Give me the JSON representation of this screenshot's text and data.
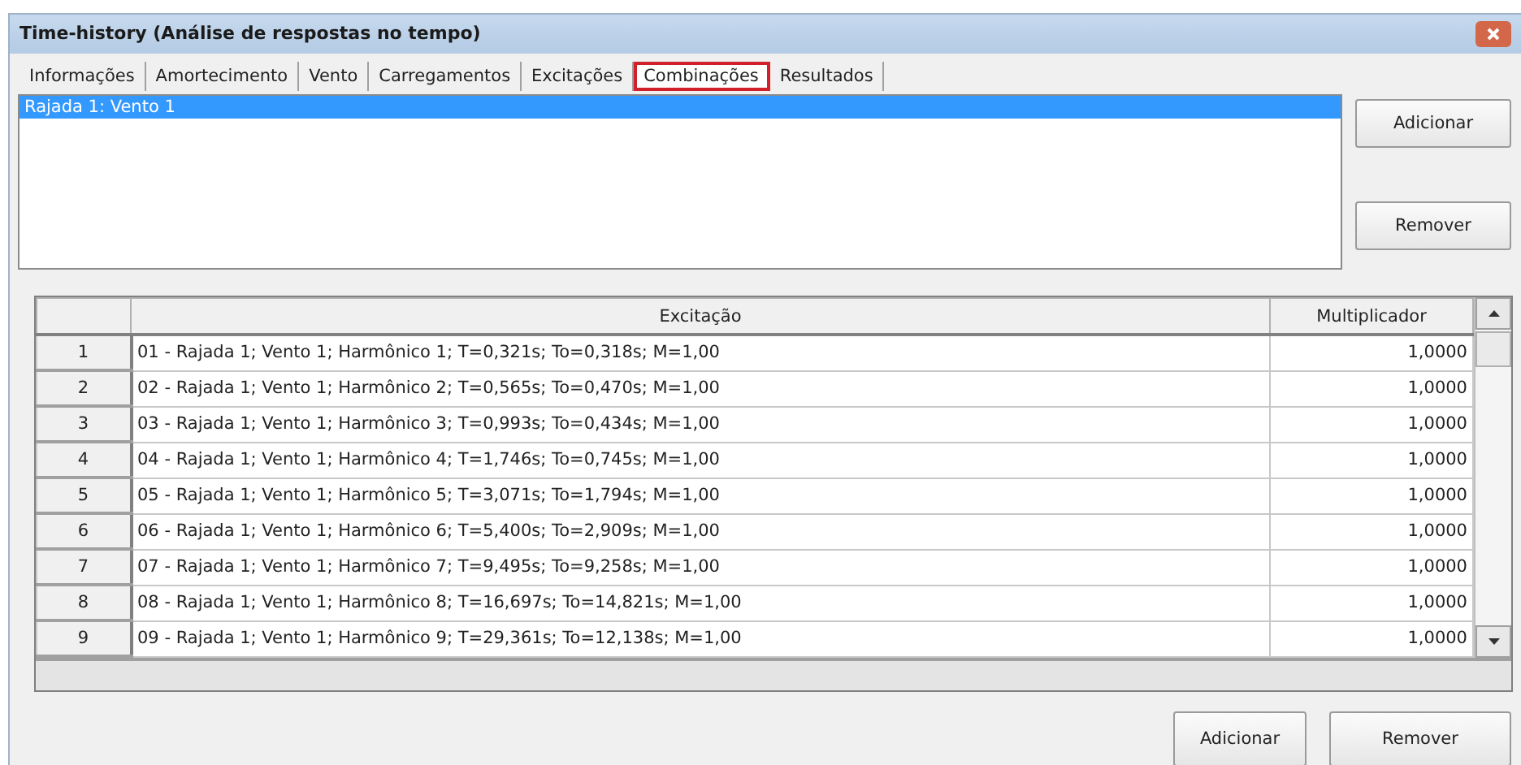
{
  "window": {
    "title": "Time-history (Análise de respostas no tempo)"
  },
  "tabs": [
    {
      "label": "Informações",
      "selected": false
    },
    {
      "label": "Amortecimento",
      "selected": false
    },
    {
      "label": "Vento",
      "selected": false
    },
    {
      "label": "Carregamentos",
      "selected": false
    },
    {
      "label": "Excitações",
      "selected": false
    },
    {
      "label": "Combinações",
      "selected": true
    },
    {
      "label": "Resultados",
      "selected": false
    }
  ],
  "combinations": {
    "items": [
      {
        "label": "Rajada 1: Vento 1",
        "selected": true
      }
    ],
    "buttons": [
      "Adicionar",
      "Remover"
    ]
  },
  "table": {
    "columns": [
      "Excitação",
      "Multiplicador"
    ],
    "rows": [
      {
        "index": "1",
        "excitation": "01 - Rajada 1; Vento 1; Harmônico 1; T=0,321s; To=0,318s; M=1,00",
        "multiplier": "1,0000"
      },
      {
        "index": "2",
        "excitation": "02 - Rajada 1; Vento 1; Harmônico 2; T=0,565s; To=0,470s; M=1,00",
        "multiplier": "1,0000"
      },
      {
        "index": "3",
        "excitation": "03 - Rajada 1; Vento 1; Harmônico 3; T=0,993s; To=0,434s; M=1,00",
        "multiplier": "1,0000"
      },
      {
        "index": "4",
        "excitation": "04 - Rajada 1; Vento 1; Harmônico 4; T=1,746s; To=0,745s; M=1,00",
        "multiplier": "1,0000"
      },
      {
        "index": "5",
        "excitation": "05 - Rajada 1; Vento 1; Harmônico 5; T=3,071s; To=1,794s; M=1,00",
        "multiplier": "1,0000"
      },
      {
        "index": "6",
        "excitation": "06 - Rajada 1; Vento 1; Harmônico 6; T=5,400s; To=2,909s; M=1,00",
        "multiplier": "1,0000"
      },
      {
        "index": "7",
        "excitation": "07 - Rajada 1; Vento 1; Harmônico 7; T=9,495s; To=9,258s; M=1,00",
        "multiplier": "1,0000"
      },
      {
        "index": "8",
        "excitation": "08 - Rajada 1; Vento 1; Harmônico 8; T=16,697s; To=14,821s; M=1,00",
        "multiplier": "1,0000"
      },
      {
        "index": "9",
        "excitation": "09 - Rajada 1; Vento 1; Harmônico 9; T=29,361s; To=12,138s; M=1,00",
        "multiplier": "1,0000"
      }
    ]
  },
  "buttons": [
    "Adicionar",
    "Remover"
  ]
}
